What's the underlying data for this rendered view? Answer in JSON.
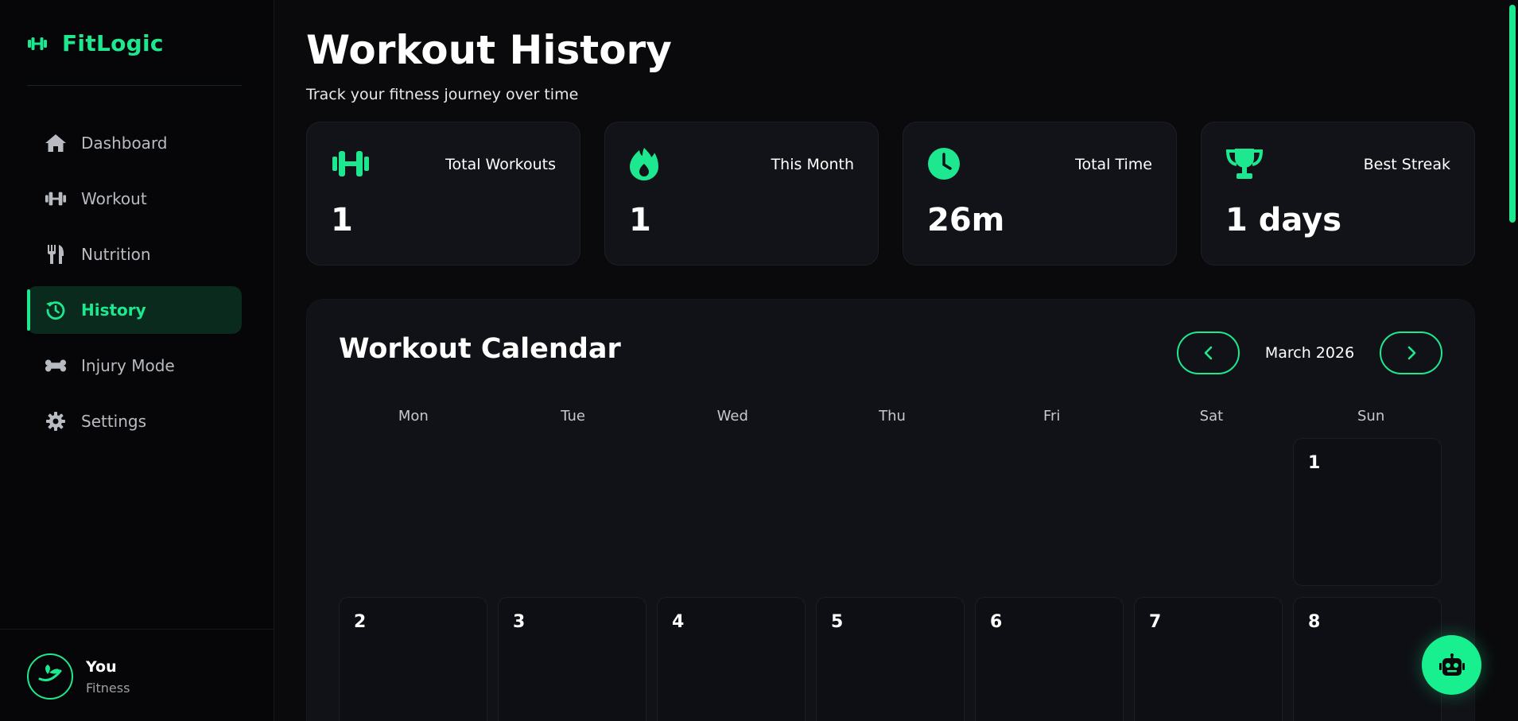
{
  "brand": {
    "name": "FitLogic",
    "icon": "dumbbell-icon"
  },
  "nav": [
    {
      "label": "Dashboard",
      "icon": "home-icon"
    },
    {
      "label": "Workout",
      "icon": "dumbbell-icon"
    },
    {
      "label": "Nutrition",
      "icon": "utensils-icon"
    },
    {
      "label": "History",
      "icon": "history-icon",
      "active": true
    },
    {
      "label": "Injury Mode",
      "icon": "bone-icon"
    },
    {
      "label": "Settings",
      "icon": "gear-icon"
    }
  ],
  "profile": {
    "name": "You",
    "role": "Fitness"
  },
  "page": {
    "title": "Workout History",
    "subtitle": "Track your fitness journey over time"
  },
  "stats": [
    {
      "label": "Total Workouts",
      "value": "1",
      "icon": "dumbbell-icon"
    },
    {
      "label": "This Month",
      "value": "1",
      "icon": "fire-icon"
    },
    {
      "label": "Total Time",
      "value": "26m",
      "icon": "clock-icon"
    },
    {
      "label": "Best Streak",
      "value": "1 days",
      "icon": "trophy-icon"
    }
  ],
  "calendar": {
    "title": "Workout Calendar",
    "month": "March 2026",
    "weekdays": [
      "Mon",
      "Tue",
      "Wed",
      "Thu",
      "Fri",
      "Sat",
      "Sun"
    ],
    "days": [
      "",
      "",
      "",
      "",
      "",
      "",
      "1",
      "2",
      "3",
      "4",
      "5",
      "6",
      "7",
      "8"
    ]
  },
  "colors": {
    "accent": "#1ee88f",
    "background": "#0a0a0d",
    "sidebar": "#060608",
    "card": "#121318"
  }
}
